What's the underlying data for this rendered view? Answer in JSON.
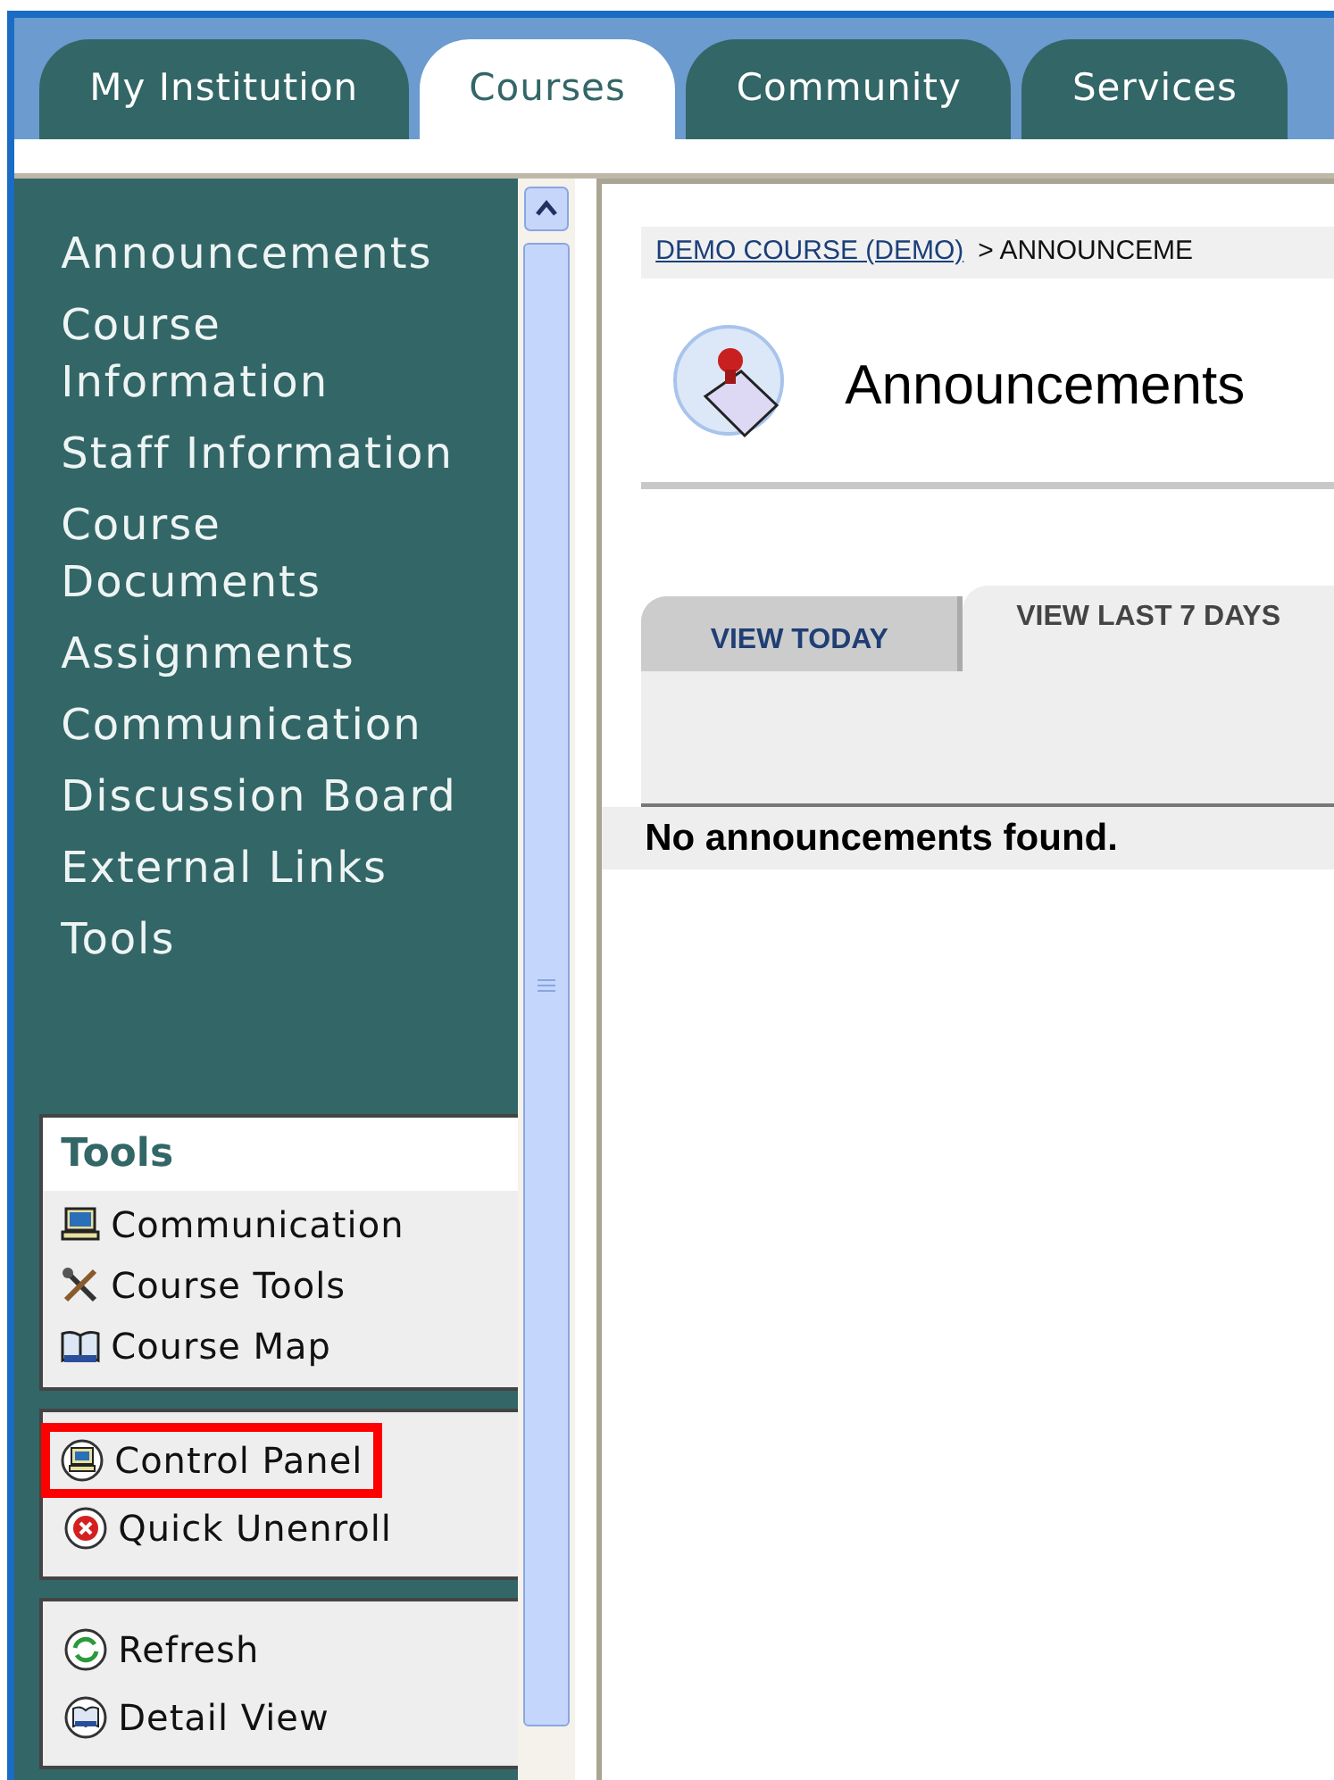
{
  "tabs": [
    {
      "label": "My Institution",
      "selected": false
    },
    {
      "label": "Courses",
      "selected": true
    },
    {
      "label": "Community",
      "selected": false
    },
    {
      "label": "Services",
      "selected": false
    }
  ],
  "sidebar": {
    "items": [
      "Announcements",
      "Course Information",
      "Staff Information",
      "Course Documents",
      "Assignments",
      "Communication",
      "Discussion Board",
      "External Links",
      "Tools"
    ],
    "tools_box": {
      "title": "Tools",
      "items": [
        {
          "label": "Communication",
          "kind": "computer"
        },
        {
          "label": "Course Tools",
          "kind": "tools"
        },
        {
          "label": "Course Map",
          "kind": "book"
        }
      ]
    },
    "boxes": [
      [
        {
          "label": "Control Panel",
          "kind": "computer",
          "highlighted": true
        },
        {
          "label": "Quick Unenroll",
          "kind": "cancel",
          "highlighted": false
        }
      ],
      [
        {
          "label": "Refresh",
          "kind": "refresh",
          "highlighted": false
        },
        {
          "label": "Detail View",
          "kind": "book",
          "highlighted": false
        }
      ]
    ]
  },
  "content": {
    "breadcrumb": {
      "link": "DEMO COURSE (DEMO)",
      "current": "> ANNOUNCEME"
    },
    "title": "Announcements",
    "view_tabs": [
      {
        "label": "VIEW TODAY",
        "selected": false
      },
      {
        "label": "VIEW LAST 7 DAYS",
        "selected": true
      }
    ],
    "message": "No announcements found."
  }
}
